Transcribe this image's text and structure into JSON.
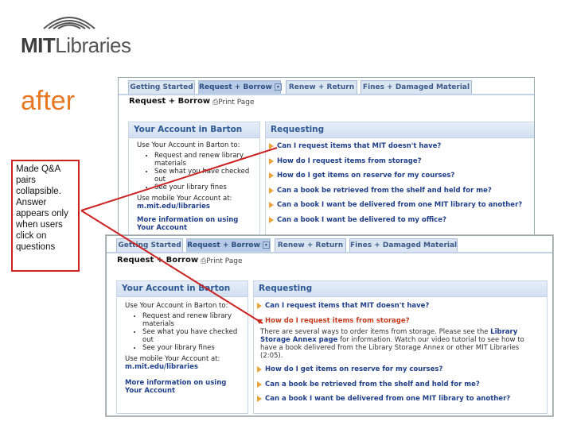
{
  "logo": {
    "brand_bold": "MIT",
    "brand_rest": "Libraries"
  },
  "slide_title": "after",
  "annotation": "Made Q&A pairs collapsible. Answer appears only when users click on questions",
  "colors": {
    "accent_orange": "#e87722",
    "annotation_red": "#cc2222",
    "link_blue": "#1f3f88",
    "open_question": "#c43b1f",
    "arrow_orange": "#e8a33c"
  },
  "tabs": [
    {
      "label": "Getting Started"
    },
    {
      "label": "Request + Borrow"
    },
    {
      "label": "Renew + Return"
    },
    {
      "label": "Fines + Damaged Material"
    }
  ],
  "subbar": {
    "crumb": "Request + Borrow",
    "print": "Print Page",
    "print_icon": "printer-icon"
  },
  "account": {
    "title": "Your Account in Barton",
    "intro": "Use Your Account in Barton to:",
    "bullets": [
      "Request and renew library materials",
      "See what you have checked out",
      "See your library fines"
    ],
    "mobile_prefix": "Use mobile Your Account at:",
    "mobile_link": "m.mit.edu/libraries",
    "more_link": "More information on using Your Account"
  },
  "requesting": {
    "title": "Requesting",
    "before_questions": [
      "Can I request items that MIT doesn't have?",
      "How do I request items from storage?",
      "How do I get items on reserve for my courses?",
      "Can a book be retrieved from the shelf and held for me?",
      "Can a book I want be delivered from one MIT library to another?",
      "Can a book I want be delivered to my office?"
    ],
    "after_questions": [
      "Can I request items that MIT doesn't have?",
      "How do I request items from storage?",
      "How do I get items on reserve for my courses?",
      "Can a book be retrieved from the shelf and held for me?",
      "Can a book I want be delivered from one MIT library to another?"
    ],
    "answer_part1": "There are several ways to order items from storage. Please see the ",
    "answer_link": "Library Storage Annex page",
    "answer_part2": " for information. Watch our video tutorial to see how to have a book delivered from the Library Storage Annex or other MIT Libraries (2:05)."
  }
}
